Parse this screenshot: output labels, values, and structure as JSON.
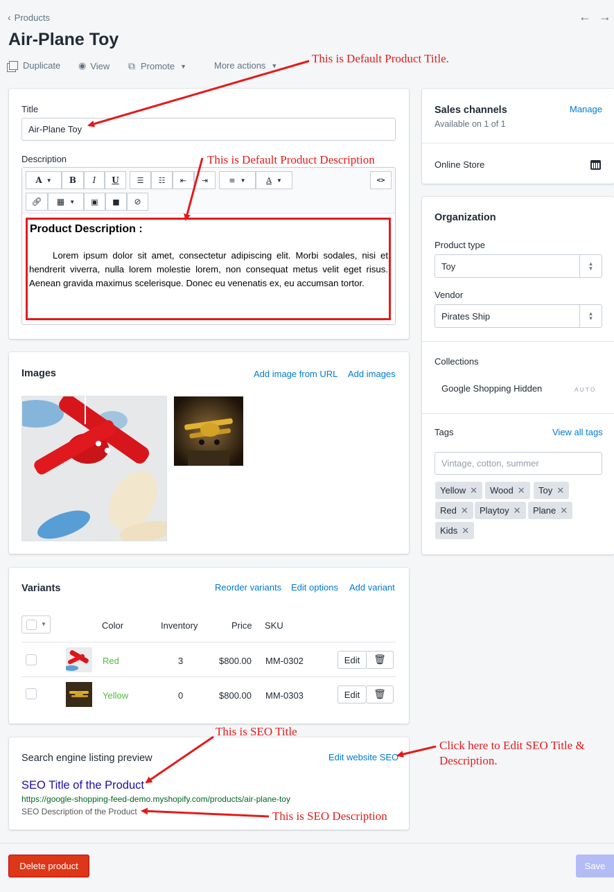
{
  "breadcrumb": {
    "label": "Products"
  },
  "page_title": "Air-Plane Toy",
  "actions": {
    "duplicate": "Duplicate",
    "view": "View",
    "promote": "Promote",
    "more": "More actions"
  },
  "title_field": {
    "label": "Title",
    "value": "Air-Plane Toy"
  },
  "description": {
    "label": "Description",
    "heading": "Product Description :",
    "body": "Lorem ipsum dolor sit amet, consectetur adipiscing elit. Morbi sodales, nisi et hendrerit viverra, nulla lorem molestie lorem, non consequat metus velit eget risus. Aenean gravida maximus scelerisque. Donec eu venenatis ex, eu accumsan tortor."
  },
  "toolbar": {
    "font_a": "A",
    "bold": "B",
    "italic": "I",
    "underline": "U",
    "color_a": "A",
    "code": "<>"
  },
  "images": {
    "heading": "Images",
    "add_url": "Add image from URL",
    "add_images": "Add images"
  },
  "variants": {
    "heading": "Variants",
    "reorder": "Reorder variants",
    "edit_options": "Edit options",
    "add_variant": "Add variant",
    "columns": [
      "Color",
      "Inventory",
      "Price",
      "SKU"
    ],
    "rows": [
      {
        "color": "Red",
        "inventory": "3",
        "price": "$800.00",
        "sku": "MM-0302",
        "edit": "Edit"
      },
      {
        "color": "Yellow",
        "inventory": "0",
        "price": "$800.00",
        "sku": "MM-0303",
        "edit": "Edit"
      }
    ]
  },
  "seo": {
    "heading": "Search engine listing preview",
    "edit": "Edit website SEO",
    "title": "SEO Title of the Product",
    "url": "https://google-shopping-feed-demo.myshopify.com/products/air-plane-toy",
    "description": "SEO Description of the Product"
  },
  "sales_channels": {
    "heading": "Sales channels",
    "manage": "Manage",
    "available": "Available on 1 of 1",
    "online_store": "Online Store"
  },
  "organization": {
    "heading": "Organization",
    "product_type_label": "Product type",
    "product_type": "Toy",
    "vendor_label": "Vendor",
    "vendor": "Pirates Ship",
    "collections_label": "Collections",
    "collection": "Google Shopping Hidden",
    "auto": "AUTO",
    "tags_label": "Tags",
    "view_all_tags": "View all tags",
    "tags_placeholder": "Vintage, cotton, summer",
    "tags": [
      "Yellow",
      "Wood",
      "Toy",
      "Red",
      "Playtoy",
      "Plane",
      "Kids"
    ]
  },
  "footer": {
    "delete": "Delete product",
    "save": "Save"
  },
  "annotations": {
    "default_title": "This is Default Product Title.",
    "default_description": "This is Default Product Description",
    "seo_title": "This is SEO Title",
    "seo_edit_1": "Click here to Edit SEO Title &",
    "seo_edit_2": "Description.",
    "seo_description": "This is SEO Description"
  },
  "colors": {
    "accent": "#007ace",
    "variant_link": "#50b83c",
    "delete": "#de3618",
    "annotation": "#e21b1b",
    "seo_title": "#1a0dab",
    "seo_url": "#006621"
  }
}
